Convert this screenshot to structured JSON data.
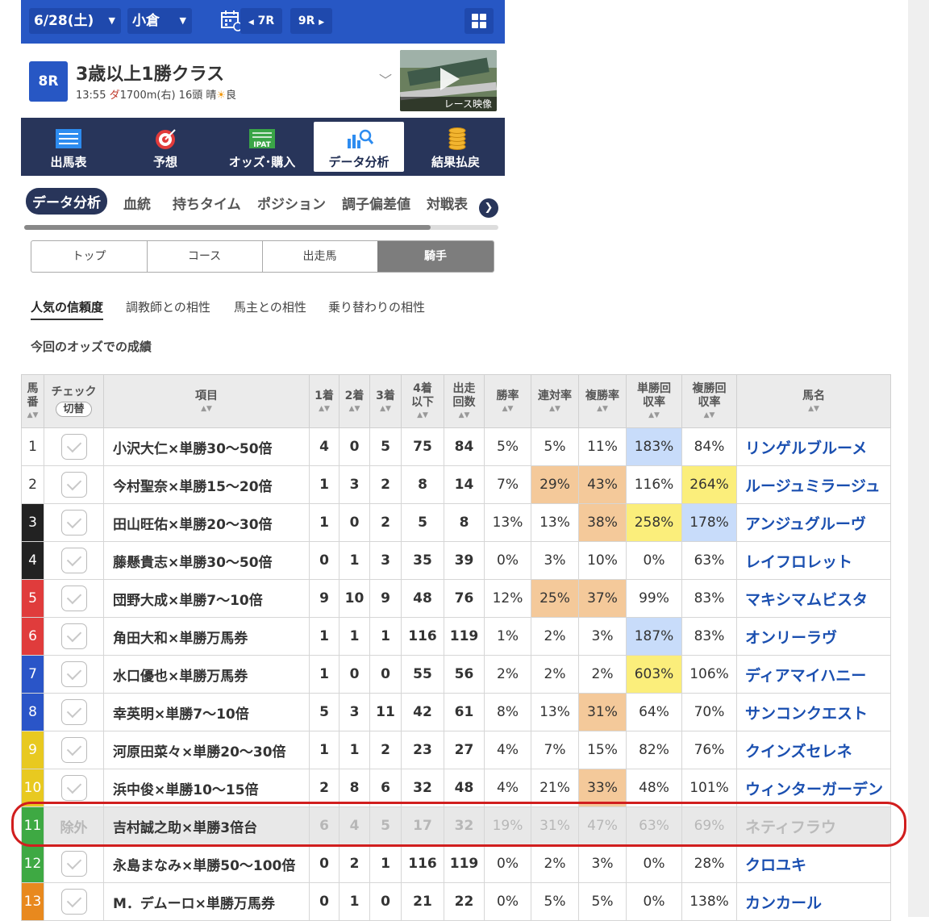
{
  "topbar": {
    "date": "6/28(土)",
    "venue": "小倉",
    "prev_race": "7R",
    "next_race": "9R"
  },
  "race": {
    "number": "8R",
    "name": "3歳以上1勝クラス",
    "time": "13:55",
    "surface": "ダ",
    "distance": "1700m(右)",
    "runners": "16頭",
    "weather": "晴",
    "condition": "良",
    "video_label": "レース映像"
  },
  "main_nav": [
    "出馬表",
    "予想",
    "オッズ･購入",
    "データ分析",
    "結果払戻"
  ],
  "sub_tabs": [
    "データ分析",
    "血統",
    "持ちタイム",
    "ポジション",
    "調子偏差値",
    "対戦表"
  ],
  "segments": [
    "トップ",
    "コース",
    "出走馬",
    "騎手"
  ],
  "sub_links": [
    "人気の信頼度",
    "調教師との相性",
    "馬主との相性",
    "乗り替わりの相性"
  ],
  "odds_caption": "今回のオッズでの成績",
  "table": {
    "headers": {
      "umaban": "馬番",
      "check": "チェック",
      "toggle": "切替",
      "item": "項目",
      "first": "1着",
      "second": "2着",
      "third": "3着",
      "fourth_below": "4着以下",
      "starts": "出走回数",
      "win_rate": "勝率",
      "quinella_rate": "連対率",
      "place_rate": "複勝率",
      "win_return": "単勝回収率",
      "place_return": "複勝回収率",
      "horse": "馬名"
    },
    "rows": [
      {
        "no": "1",
        "item": "小沢大仁×単勝30～50倍",
        "c1": "4",
        "c2": "0",
        "c3": "5",
        "c4": "75",
        "n": "84",
        "win": "5%",
        "quin": "5%",
        "place": "11%",
        "winret": "183%",
        "placeret": "84%",
        "horse": "リンゲルブルーメ",
        "excluded": ""
      },
      {
        "no": "2",
        "item": "今村聖奈×単勝15～20倍",
        "c1": "1",
        "c2": "3",
        "c3": "2",
        "c4": "8",
        "n": "14",
        "win": "7%",
        "quin": "29%",
        "place": "43%",
        "winret": "116%",
        "placeret": "264%",
        "horse": "ルージュミラージュ",
        "excluded": ""
      },
      {
        "no": "3",
        "item": "田山旺佑×単勝20～30倍",
        "c1": "1",
        "c2": "0",
        "c3": "2",
        "c4": "5",
        "n": "8",
        "win": "13%",
        "quin": "13%",
        "place": "38%",
        "winret": "258%",
        "placeret": "178%",
        "horse": "アンジュグルーヴ",
        "excluded": ""
      },
      {
        "no": "4",
        "item": "藤懸貴志×単勝30～50倍",
        "c1": "0",
        "c2": "1",
        "c3": "3",
        "c4": "35",
        "n": "39",
        "win": "0%",
        "quin": "3%",
        "place": "10%",
        "winret": "0%",
        "placeret": "63%",
        "horse": "レイフロレット",
        "excluded": ""
      },
      {
        "no": "5",
        "item": "団野大成×単勝7～10倍",
        "c1": "9",
        "c2": "10",
        "c3": "9",
        "c4": "48",
        "n": "76",
        "win": "12%",
        "quin": "25%",
        "place": "37%",
        "winret": "99%",
        "placeret": "83%",
        "horse": "マキシマムビスタ",
        "excluded": ""
      },
      {
        "no": "6",
        "item": "角田大和×単勝万馬券",
        "c1": "1",
        "c2": "1",
        "c3": "1",
        "c4": "116",
        "n": "119",
        "win": "1%",
        "quin": "2%",
        "place": "3%",
        "winret": "187%",
        "placeret": "83%",
        "horse": "オンリーラヴ",
        "excluded": ""
      },
      {
        "no": "7",
        "item": "水口優也×単勝万馬券",
        "c1": "1",
        "c2": "0",
        "c3": "0",
        "c4": "55",
        "n": "56",
        "win": "2%",
        "quin": "2%",
        "place": "2%",
        "winret": "603%",
        "placeret": "106%",
        "horse": "ディアマイハニー",
        "excluded": ""
      },
      {
        "no": "8",
        "item": "幸英明×単勝7～10倍",
        "c1": "5",
        "c2": "3",
        "c3": "11",
        "c4": "42",
        "n": "61",
        "win": "8%",
        "quin": "13%",
        "place": "31%",
        "winret": "64%",
        "placeret": "70%",
        "horse": "サンコンクエスト",
        "excluded": ""
      },
      {
        "no": "9",
        "item": "河原田菜々×単勝20～30倍",
        "c1": "1",
        "c2": "1",
        "c3": "2",
        "c4": "23",
        "n": "27",
        "win": "4%",
        "quin": "7%",
        "place": "15%",
        "winret": "82%",
        "placeret": "76%",
        "horse": "クインズセレネ",
        "excluded": ""
      },
      {
        "no": "10",
        "item": "浜中俊×単勝10～15倍",
        "c1": "2",
        "c2": "8",
        "c3": "6",
        "c4": "32",
        "n": "48",
        "win": "4%",
        "quin": "21%",
        "place": "33%",
        "winret": "48%",
        "placeret": "101%",
        "horse": "ウィンターガーデン",
        "excluded": ""
      },
      {
        "no": "11",
        "item": "吉村誠之助×単勝3倍台",
        "c1": "6",
        "c2": "4",
        "c3": "5",
        "c4": "17",
        "n": "32",
        "win": "19%",
        "quin": "31%",
        "place": "47%",
        "winret": "63%",
        "placeret": "69%",
        "horse": "ネティフラウ",
        "excluded": "除外"
      },
      {
        "no": "12",
        "item": "永島まなみ×単勝50～100倍",
        "c1": "0",
        "c2": "2",
        "c3": "1",
        "c4": "116",
        "n": "119",
        "win": "0%",
        "quin": "2%",
        "place": "3%",
        "winret": "0%",
        "placeret": "28%",
        "horse": "クロユキ",
        "excluded": ""
      },
      {
        "no": "13",
        "item": "M．デムーロ×単勝万馬券",
        "c1": "0",
        "c2": "1",
        "c3": "0",
        "c4": "21",
        "n": "22",
        "win": "0%",
        "quin": "5%",
        "place": "5%",
        "winret": "0%",
        "placeret": "138%",
        "horse": "カンカール",
        "excluded": ""
      }
    ]
  },
  "colors": {
    "brand_blue": "#2757c4",
    "nav_navy": "#28355a",
    "highlight_orange": "#f4c99a",
    "highlight_yellow": "#fbee7b",
    "highlight_blue": "#c8dcfa",
    "annotation_red": "#d11e1e",
    "frame_colors": [
      "#ffffff",
      "#ffffff",
      "#222222",
      "#222222",
      "#e03c3c",
      "#e03c3c",
      "#2a55c8",
      "#2a55c8",
      "#e8c920",
      "#e8c920",
      "#3ea943",
      "#3ea943",
      "#e8891e"
    ]
  }
}
